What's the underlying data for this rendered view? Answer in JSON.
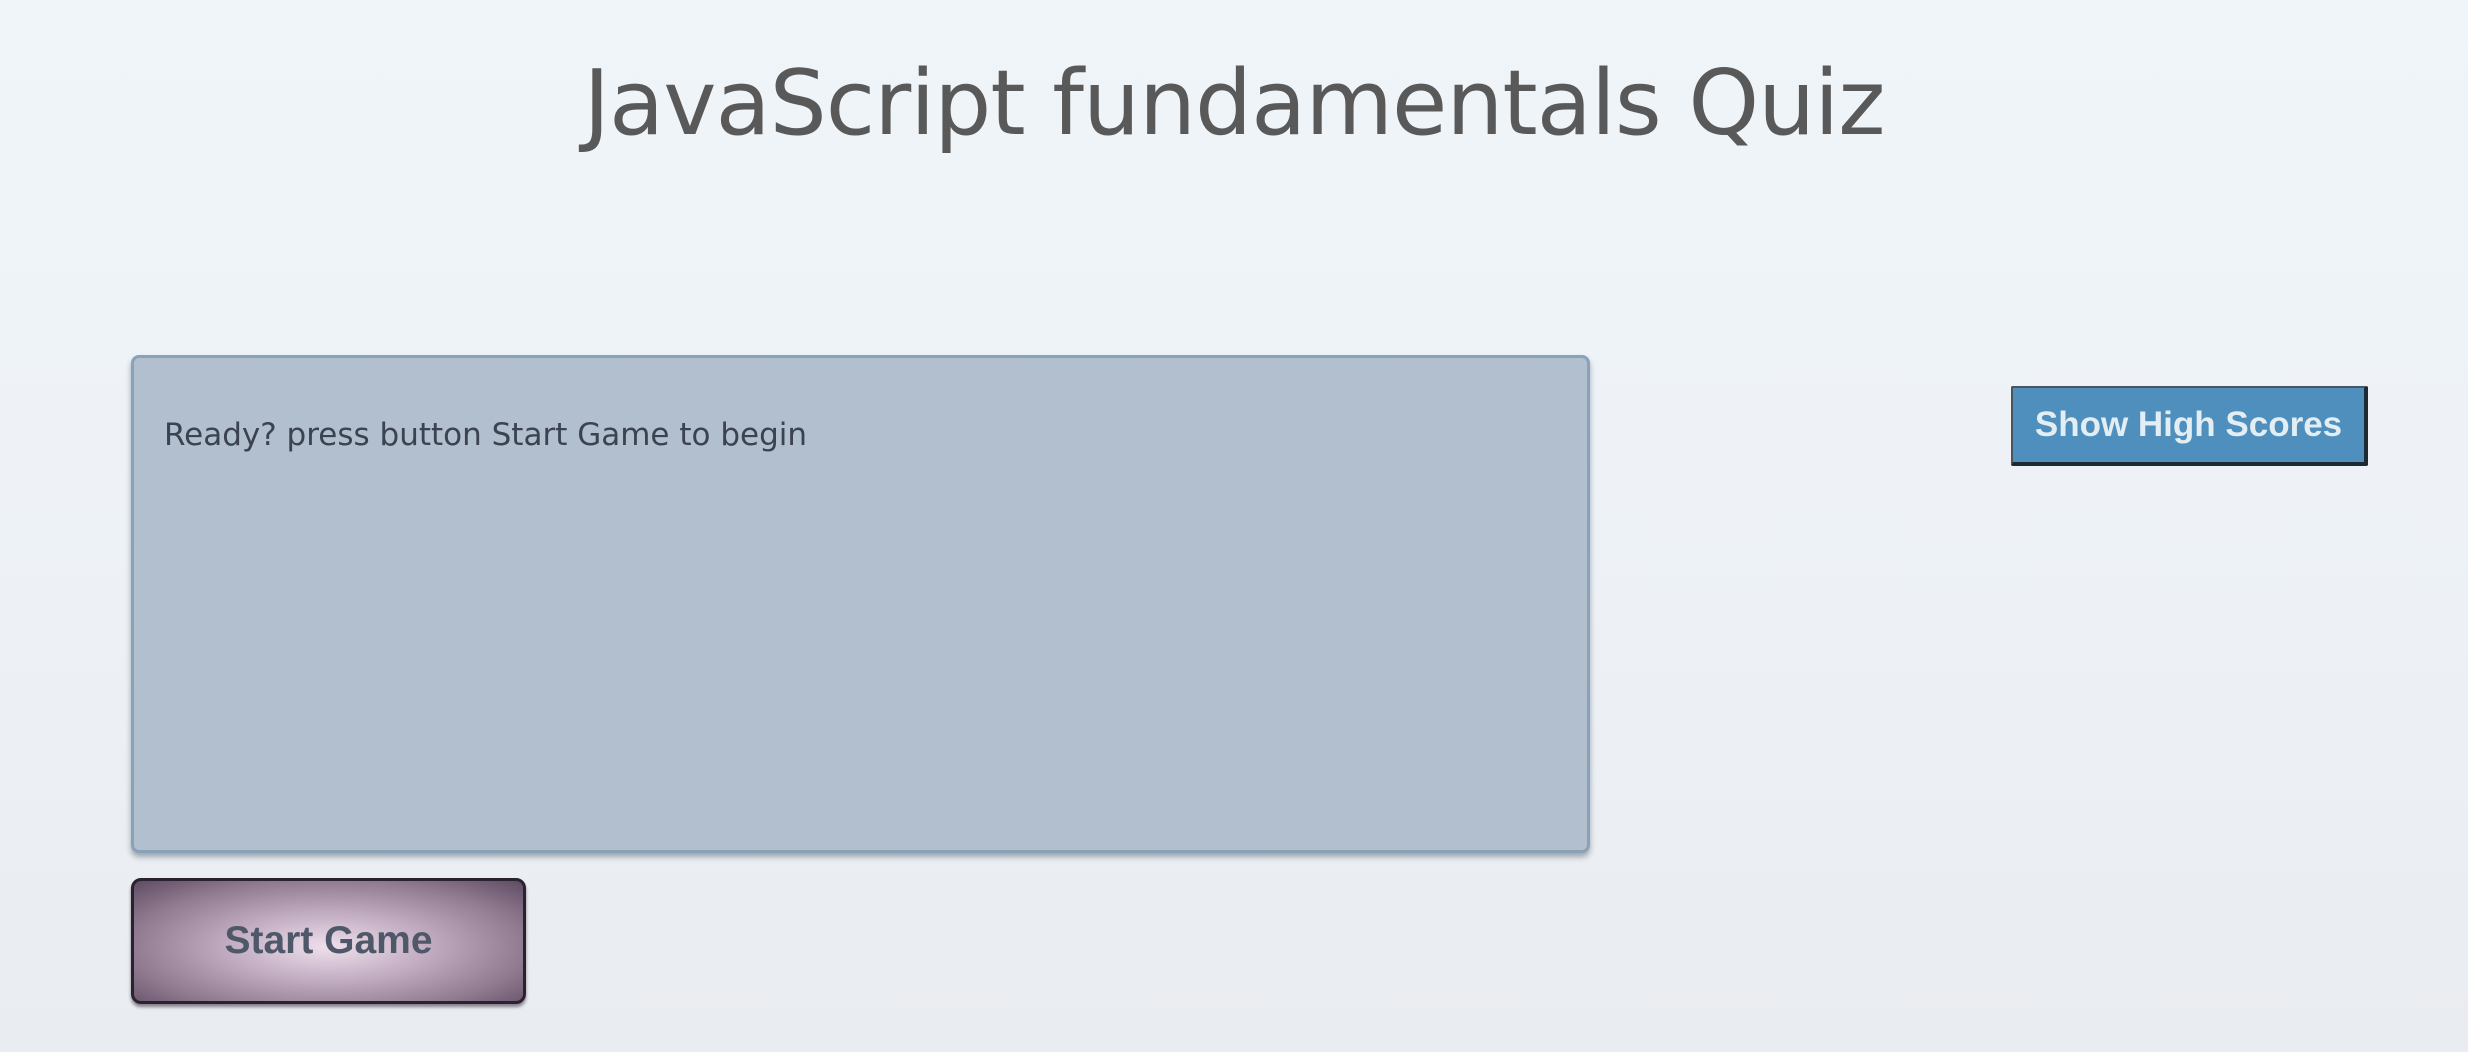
{
  "header": {
    "title": "JavaScript fundamentals Quiz"
  },
  "quiz_panel": {
    "message": "Ready? press button Start Game to begin"
  },
  "controls": {
    "start_label": "Start Game",
    "high_scores_label": "Show High Scores"
  },
  "colors": {
    "panel_background": "#b1bfcf",
    "high_scores_button": "#4f8fbd",
    "title_text": "#595959"
  }
}
